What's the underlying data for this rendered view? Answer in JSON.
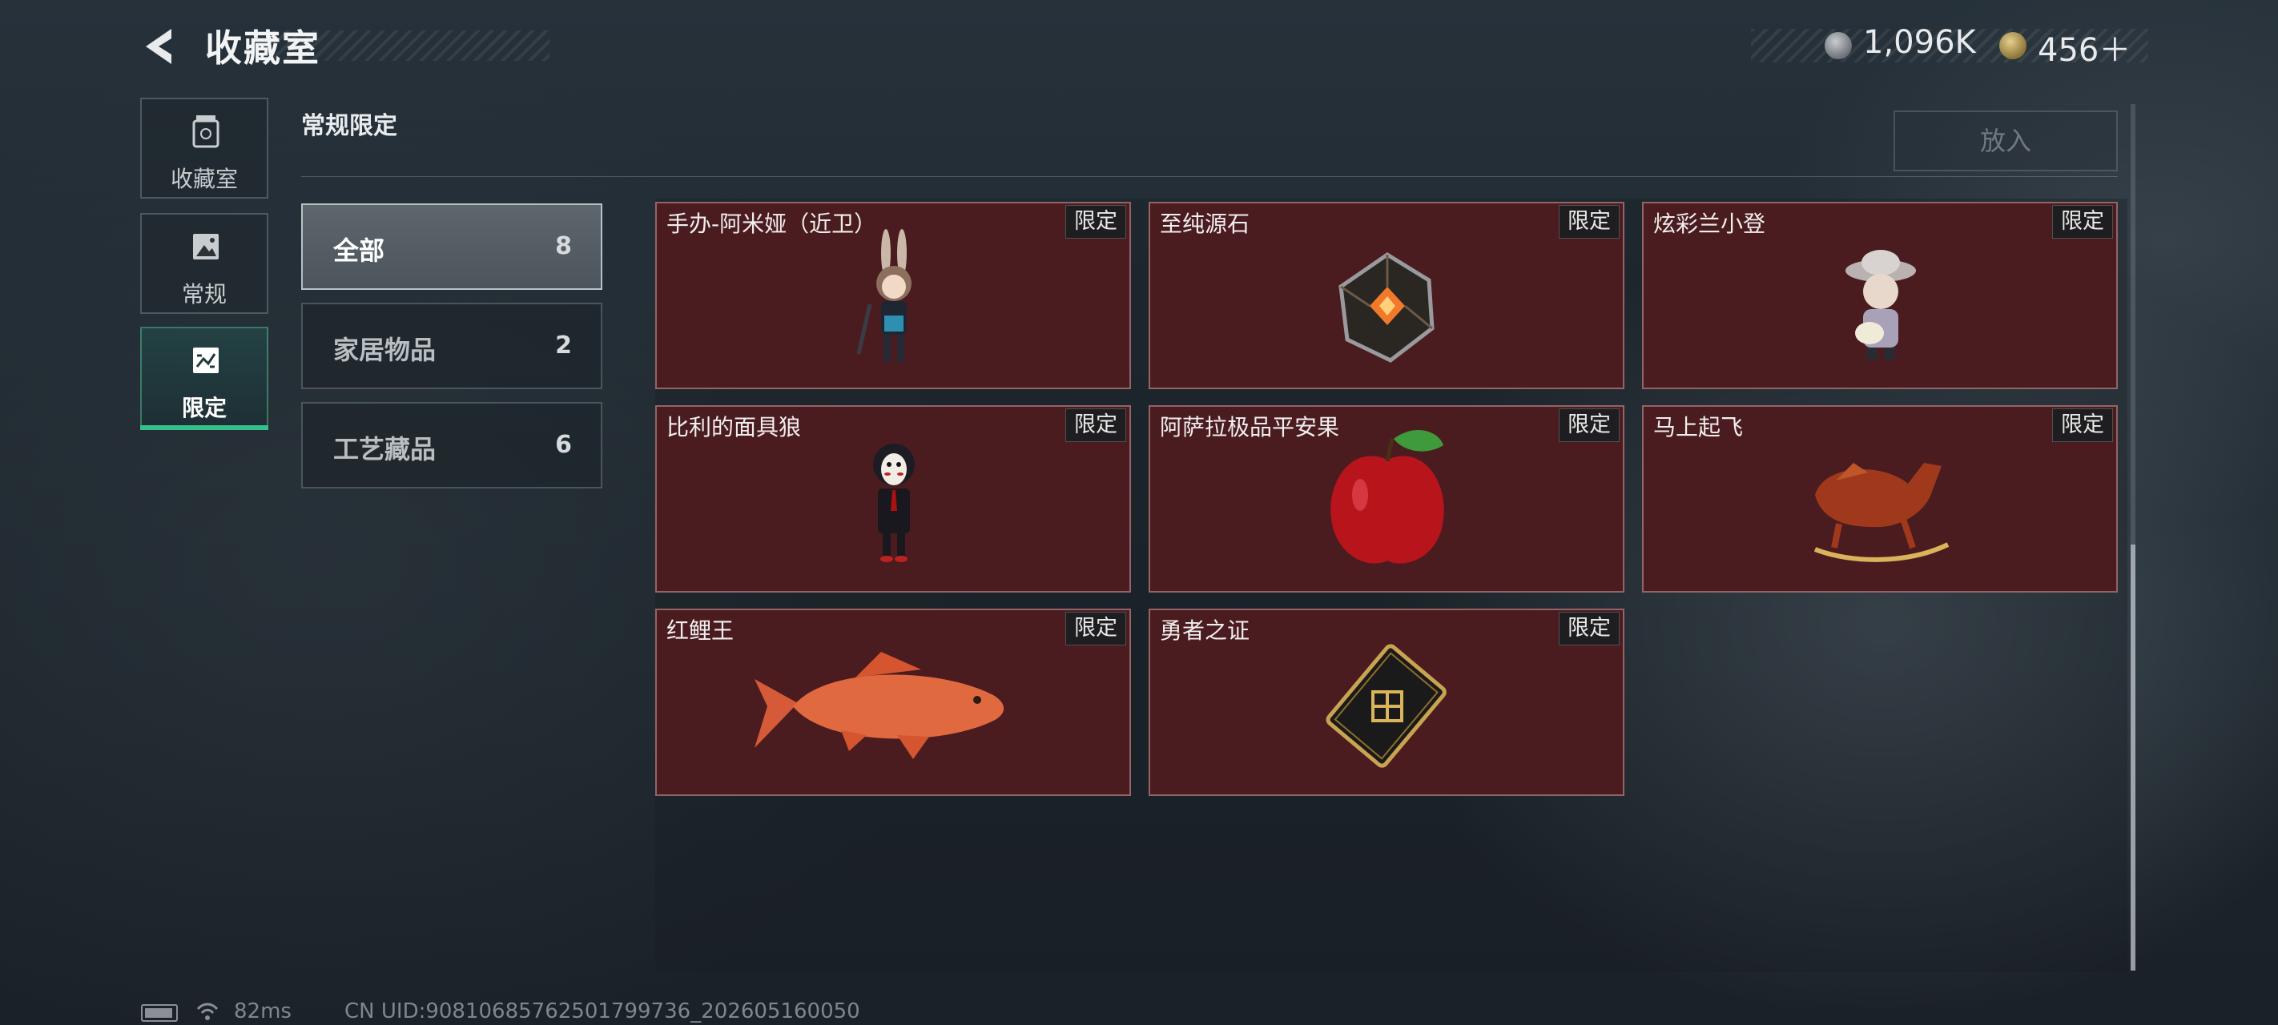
{
  "header": {
    "title": "收藏室",
    "currency1": "1,096K",
    "currency2": "456＋"
  },
  "nav": {
    "items": [
      {
        "label": "收藏室",
        "icon": "jar-icon"
      },
      {
        "label": "常规",
        "icon": "picture-icon"
      },
      {
        "label": "限定",
        "icon": "limited-icon",
        "active": true
      }
    ]
  },
  "section": {
    "title": "常规限定",
    "put_button": "放入"
  },
  "categories": [
    {
      "name": "全部",
      "count": "8",
      "active": true
    },
    {
      "name": "家居物品",
      "count": "2"
    },
    {
      "name": "工艺藏品",
      "count": "6"
    }
  ],
  "items": [
    {
      "name": "手办-阿米娅（近卫）",
      "tag": "限定"
    },
    {
      "name": "至纯源石",
      "tag": "限定"
    },
    {
      "name": "炫彩兰小登",
      "tag": "限定"
    },
    {
      "name": "比利的面具狼",
      "tag": "限定"
    },
    {
      "name": "阿萨拉极品平安果",
      "tag": "限定"
    },
    {
      "name": "马上起飞",
      "tag": "限定"
    },
    {
      "name": "红鲤王",
      "tag": "限定"
    },
    {
      "name": "勇者之证",
      "tag": "限定"
    }
  ],
  "footer": {
    "ping": "82ms",
    "uid": "CN UID:90810685762501799736_202605160050"
  },
  "colors": {
    "accent": "#35c08b",
    "card_bg": "#4a1c20"
  }
}
